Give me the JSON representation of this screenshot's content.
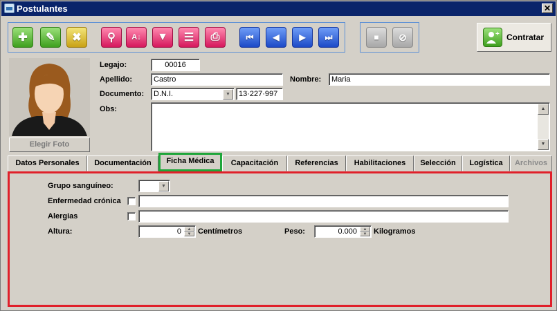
{
  "window": {
    "title": "Postulantes",
    "close": "✕"
  },
  "toolbar": {
    "contratar_label": "Contratar"
  },
  "photo": {
    "button_label": "Elegir Foto"
  },
  "form": {
    "legajo_label": "Legajo:",
    "legajo_value": "00016",
    "apellido_label": "Apellido:",
    "apellido_value": "Castro",
    "nombre_label": "Nombre:",
    "nombre_value": "Maria",
    "documento_label": "Documento:",
    "documento_type": "D.N.I.",
    "documento_value": "13·227·997",
    "obs_label": "Obs:",
    "obs_value": ""
  },
  "tabs": [
    "Datos Personales",
    "Documentación",
    "Ficha Médica",
    "Capacitación",
    "Referencias",
    "Habilitaciones",
    "Selección",
    "Logística",
    "Archivos"
  ],
  "ficha": {
    "grupo_label": "Grupo sanguíneo:",
    "grupo_value": "",
    "enfermedad_label": "Enfermedad crónica",
    "enfermedad_value": "",
    "alergias_label": "Alergias",
    "alergias_value": "",
    "altura_label": "Altura:",
    "altura_value": "0",
    "altura_unit": "Centímetros",
    "peso_label": "Peso:",
    "peso_value": "0.000",
    "peso_unit": "Kilogramos"
  },
  "colors": {
    "title_bar": "#0a246a",
    "active_tab_outline": "#1fa63a",
    "panel_outline": "#e0202a"
  }
}
